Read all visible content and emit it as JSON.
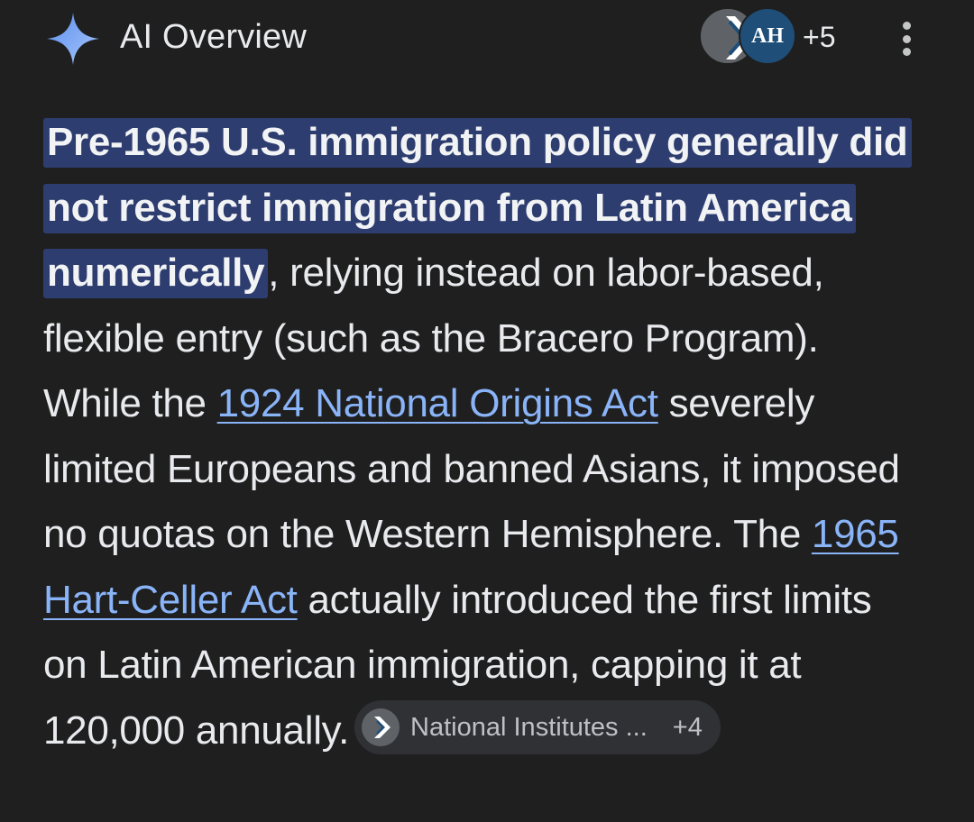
{
  "header": {
    "title": "AI Overview",
    "sources_count": "+5",
    "source_avatars": [
      {
        "name": "chevron-logo",
        "color": "#5f6368"
      },
      {
        "name": "AH",
        "color": "#1f4e79"
      }
    ],
    "icons": {
      "sparkle": "sparkle-icon",
      "more": "more-vert-icon"
    }
  },
  "answer": {
    "highlight": "Pre-1965 U.S. immigration policy generally did not restrict immigration from Latin America numerically",
    "part1": ", relying instead on labor-based, flexible entry (such as the Bracero Program). While the ",
    "link1": "1924 National Origins Act",
    "part2": " severely limited Europeans and banned Asians, it imposed no quotas on the Western Hemisphere. The ",
    "link2": "1965 Hart-Celler Act",
    "part3": " actually introduced the first limits on Latin American immigration, capping it at 120,000 annually.",
    "citation": {
      "label": "National Institutes ...",
      "count": "+4",
      "icon": "chevron-logo-icon"
    }
  },
  "colors": {
    "background": "#1f1f1f",
    "text": "#e8eaed",
    "highlight_bg": "#2e3d70",
    "link": "#8ab4f8",
    "chip_bg": "#303134"
  }
}
